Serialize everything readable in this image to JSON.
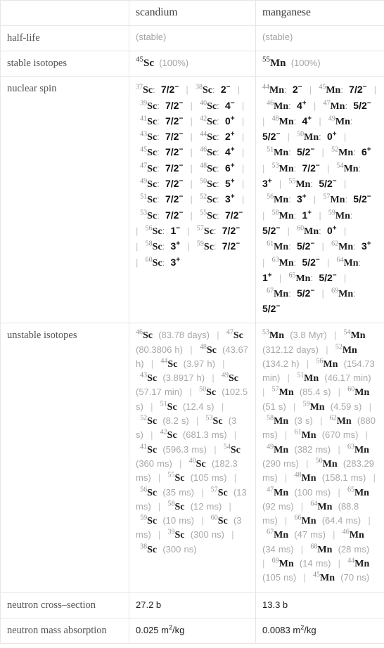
{
  "table": {
    "columns": [
      "",
      "scandium",
      "manganese"
    ],
    "rows": [
      {
        "label": "half-life",
        "scandium": "(stable)",
        "manganese": "(stable)",
        "type": "muted"
      },
      {
        "label": "stable isotopes",
        "type": "stable-isotopes",
        "scandium": {
          "mass": "45",
          "symbol": "Sc",
          "abundance": "(100%)"
        },
        "manganese": {
          "mass": "55",
          "symbol": "Mn",
          "abundance": "(100%)"
        }
      },
      {
        "label": "nuclear spin",
        "type": "spin-list"
      },
      {
        "label": "unstable isotopes",
        "type": "isotope-list"
      },
      {
        "label": "neutron cross–section",
        "scandium": "27.2 b",
        "manganese": "13.3 b",
        "type": "value"
      },
      {
        "label": "neutron mass absorption",
        "scandium_num": "0.025 m",
        "scandium_sup": "2",
        "scandium_unit": "/kg",
        "manganese_num": "0.0083 m",
        "manganese_sup": "2",
        "manganese_unit": "/kg",
        "type": "value-sup"
      }
    ]
  },
  "nuclear_spin": {
    "scandium": [
      {
        "mass": "37",
        "symbol": "Sc",
        "spin": "7/2",
        "sign": "−"
      },
      {
        "mass": "38",
        "symbol": "Sc",
        "spin": "2",
        "sign": "−"
      },
      {
        "mass": "39",
        "symbol": "Sc",
        "spin": "7/2",
        "sign": "−"
      },
      {
        "mass": "40",
        "symbol": "Sc",
        "spin": "4",
        "sign": "−"
      },
      {
        "mass": "41",
        "symbol": "Sc",
        "spin": "7/2",
        "sign": "−"
      },
      {
        "mass": "42",
        "symbol": "Sc",
        "spin": "0",
        "sign": "+"
      },
      {
        "mass": "43",
        "symbol": "Sc",
        "spin": "7/2",
        "sign": "−"
      },
      {
        "mass": "44",
        "symbol": "Sc",
        "spin": "2",
        "sign": "+"
      },
      {
        "mass": "45",
        "symbol": "Sc",
        "spin": "7/2",
        "sign": "−"
      },
      {
        "mass": "46",
        "symbol": "Sc",
        "spin": "4",
        "sign": "+"
      },
      {
        "mass": "47",
        "symbol": "Sc",
        "spin": "7/2",
        "sign": "−"
      },
      {
        "mass": "48",
        "symbol": "Sc",
        "spin": "6",
        "sign": "+"
      },
      {
        "mass": "49",
        "symbol": "Sc",
        "spin": "7/2",
        "sign": "−"
      },
      {
        "mass": "50",
        "symbol": "Sc",
        "spin": "5",
        "sign": "+"
      },
      {
        "mass": "51",
        "symbol": "Sc",
        "spin": "7/2",
        "sign": "−"
      },
      {
        "mass": "52",
        "symbol": "Sc",
        "spin": "3",
        "sign": "+"
      },
      {
        "mass": "53",
        "symbol": "Sc",
        "spin": "7/2",
        "sign": "−"
      },
      {
        "mass": "55",
        "symbol": "Sc",
        "spin": "7/2",
        "sign": "−"
      },
      {
        "mass": "56",
        "symbol": "Sc",
        "spin": "1",
        "sign": "−"
      },
      {
        "mass": "57",
        "symbol": "Sc",
        "spin": "7/2",
        "sign": "−"
      },
      {
        "mass": "58",
        "symbol": "Sc",
        "spin": "3",
        "sign": "+"
      },
      {
        "mass": "59",
        "symbol": "Sc",
        "spin": "7/2",
        "sign": "−"
      },
      {
        "mass": "60",
        "symbol": "Sc",
        "spin": "3",
        "sign": "+"
      }
    ],
    "manganese": [
      {
        "mass": "44",
        "symbol": "Mn",
        "spin": "2",
        "sign": "−"
      },
      {
        "mass": "45",
        "symbol": "Mn",
        "spin": "7/2",
        "sign": "−"
      },
      {
        "mass": "46",
        "symbol": "Mn",
        "spin": "4",
        "sign": "+"
      },
      {
        "mass": "47",
        "symbol": "Mn",
        "spin": "5/2",
        "sign": "−"
      },
      {
        "mass": "48",
        "symbol": "Mn",
        "spin": "4",
        "sign": "+"
      },
      {
        "mass": "49",
        "symbol": "Mn",
        "spin": "5/2",
        "sign": "−"
      },
      {
        "mass": "50",
        "symbol": "Mn",
        "spin": "0",
        "sign": "+"
      },
      {
        "mass": "51",
        "symbol": "Mn",
        "spin": "5/2",
        "sign": "−"
      },
      {
        "mass": "52",
        "symbol": "Mn",
        "spin": "6",
        "sign": "+"
      },
      {
        "mass": "53",
        "symbol": "Mn",
        "spin": "7/2",
        "sign": "−"
      },
      {
        "mass": "54",
        "symbol": "Mn",
        "spin": "3",
        "sign": "+"
      },
      {
        "mass": "55",
        "symbol": "Mn",
        "spin": "5/2",
        "sign": "−"
      },
      {
        "mass": "56",
        "symbol": "Mn",
        "spin": "3",
        "sign": "+"
      },
      {
        "mass": "57",
        "symbol": "Mn",
        "spin": "5/2",
        "sign": "−"
      },
      {
        "mass": "58",
        "symbol": "Mn",
        "spin": "1",
        "sign": "+"
      },
      {
        "mass": "59",
        "symbol": "Mn",
        "spin": "5/2",
        "sign": "−"
      },
      {
        "mass": "60",
        "symbol": "Mn",
        "spin": "0",
        "sign": "+"
      },
      {
        "mass": "61",
        "symbol": "Mn",
        "spin": "5/2",
        "sign": "−"
      },
      {
        "mass": "62",
        "symbol": "Mn",
        "spin": "3",
        "sign": "+"
      },
      {
        "mass": "63",
        "symbol": "Mn",
        "spin": "5/2",
        "sign": "−"
      },
      {
        "mass": "64",
        "symbol": "Mn",
        "spin": "1",
        "sign": "+"
      },
      {
        "mass": "65",
        "symbol": "Mn",
        "spin": "5/2",
        "sign": "−"
      },
      {
        "mass": "67",
        "symbol": "Mn",
        "spin": "5/2",
        "sign": "−"
      },
      {
        "mass": "69",
        "symbol": "Mn",
        "spin": "5/2",
        "sign": "−"
      }
    ]
  },
  "unstable_isotopes": {
    "scandium": [
      {
        "mass": "46",
        "symbol": "Sc",
        "halflife": "(83.78 days)"
      },
      {
        "mass": "47",
        "symbol": "Sc",
        "halflife": "(80.3806 h)"
      },
      {
        "mass": "48",
        "symbol": "Sc",
        "halflife": "(43.67 h)"
      },
      {
        "mass": "44",
        "symbol": "Sc",
        "halflife": "(3.97 h)"
      },
      {
        "mass": "43",
        "symbol": "Sc",
        "halflife": "(3.8917 h)"
      },
      {
        "mass": "49",
        "symbol": "Sc",
        "halflife": "(57.17 min)"
      },
      {
        "mass": "50",
        "symbol": "Sc",
        "halflife": "(102.5 s)"
      },
      {
        "mass": "51",
        "symbol": "Sc",
        "halflife": "(12.4 s)"
      },
      {
        "mass": "52",
        "symbol": "Sc",
        "halflife": "(8.2 s)"
      },
      {
        "mass": "53",
        "symbol": "Sc",
        "halflife": "(3 s)"
      },
      {
        "mass": "42",
        "symbol": "Sc",
        "halflife": "(681.3 ms)"
      },
      {
        "mass": "41",
        "symbol": "Sc",
        "halflife": "(596.3 ms)"
      },
      {
        "mass": "54",
        "symbol": "Sc",
        "halflife": "(360 ms)"
      },
      {
        "mass": "40",
        "symbol": "Sc",
        "halflife": "(182.3 ms)"
      },
      {
        "mass": "55",
        "symbol": "Sc",
        "halflife": "(105 ms)"
      },
      {
        "mass": "56",
        "symbol": "Sc",
        "halflife": "(35 ms)"
      },
      {
        "mass": "57",
        "symbol": "Sc",
        "halflife": "(13 ms)"
      },
      {
        "mass": "58",
        "symbol": "Sc",
        "halflife": "(12 ms)"
      },
      {
        "mass": "59",
        "symbol": "Sc",
        "halflife": "(10 ms)"
      },
      {
        "mass": "60",
        "symbol": "Sc",
        "halflife": "(3 ms)"
      },
      {
        "mass": "39",
        "symbol": "Sc",
        "halflife": "(300 ns)"
      },
      {
        "mass": "38",
        "symbol": "Sc",
        "halflife": "(300 ns)"
      }
    ],
    "manganese": [
      {
        "mass": "53",
        "symbol": "Mn",
        "halflife": "(3.8 Myr)"
      },
      {
        "mass": "54",
        "symbol": "Mn",
        "halflife": "(312.12 days)"
      },
      {
        "mass": "52",
        "symbol": "Mn",
        "halflife": "(134.2 h)"
      },
      {
        "mass": "56",
        "symbol": "Mn",
        "halflife": "(154.73 min)"
      },
      {
        "mass": "51",
        "symbol": "Mn",
        "halflife": "(46.17 min)"
      },
      {
        "mass": "57",
        "symbol": "Mn",
        "halflife": "(85.4 s)"
      },
      {
        "mass": "60",
        "symbol": "Mn",
        "halflife": "(51 s)"
      },
      {
        "mass": "59",
        "symbol": "Mn",
        "halflife": "(4.59 s)"
      },
      {
        "mass": "58",
        "symbol": "Mn",
        "halflife": "(3 s)"
      },
      {
        "mass": "62",
        "symbol": "Mn",
        "halflife": "(880 ms)"
      },
      {
        "mass": "61",
        "symbol": "Mn",
        "halflife": "(670 ms)"
      },
      {
        "mass": "49",
        "symbol": "Mn",
        "halflife": "(382 ms)"
      },
      {
        "mass": "63",
        "symbol": "Mn",
        "halflife": "(290 ms)"
      },
      {
        "mass": "50",
        "symbol": "Mn",
        "halflife": "(283.29 ms)"
      },
      {
        "mass": "48",
        "symbol": "Mn",
        "halflife": "(158.1 ms)"
      },
      {
        "mass": "47",
        "symbol": "Mn",
        "halflife": "(100 ms)"
      },
      {
        "mass": "65",
        "symbol": "Mn",
        "halflife": "(92 ms)"
      },
      {
        "mass": "64",
        "symbol": "Mn",
        "halflife": "(88.8 ms)"
      },
      {
        "mass": "66",
        "symbol": "Mn",
        "halflife": "(64.4 ms)"
      },
      {
        "mass": "67",
        "symbol": "Mn",
        "halflife": "(47 ms)"
      },
      {
        "mass": "46",
        "symbol": "Mn",
        "halflife": "(34 ms)"
      },
      {
        "mass": "68",
        "symbol": "Mn",
        "halflife": "(28 ms)"
      },
      {
        "mass": "69",
        "symbol": "Mn",
        "halflife": "(14 ms)"
      },
      {
        "mass": "44",
        "symbol": "Mn",
        "halflife": "(105 ns)"
      },
      {
        "mass": "45",
        "symbol": "Mn",
        "halflife": "(70 ns)"
      }
    ]
  },
  "separator": "|"
}
